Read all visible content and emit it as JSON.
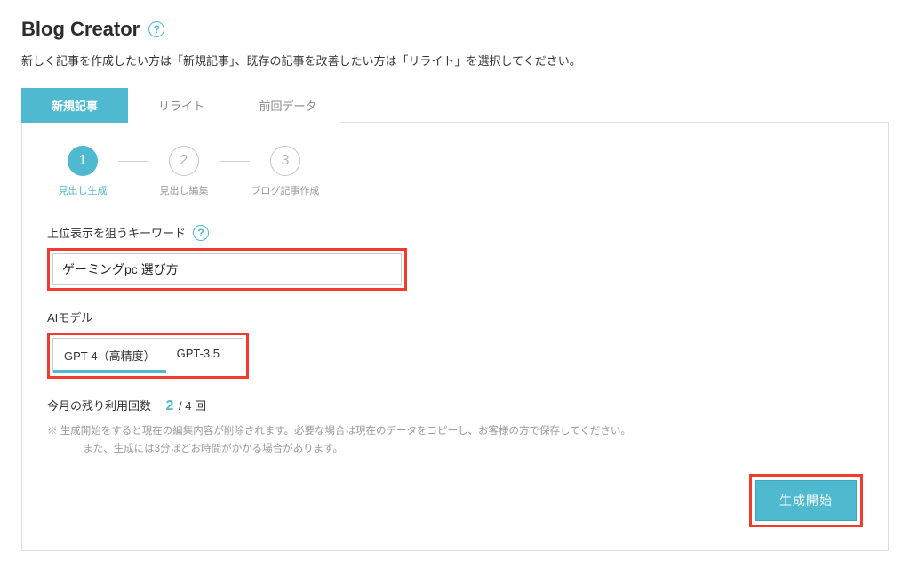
{
  "header": {
    "title": "Blog Creator",
    "subtitle": "新しく記事を作成したい方は「新規記事」、既存の記事を改善したい方は「リライト」を選択してください。"
  },
  "tabs": [
    {
      "label": "新規記事",
      "active": true
    },
    {
      "label": "リライト",
      "active": false
    },
    {
      "label": "前回データ",
      "active": false
    }
  ],
  "steps": [
    {
      "num": "1",
      "label": "見出し生成",
      "active": true
    },
    {
      "num": "2",
      "label": "見出し編集",
      "active": false
    },
    {
      "num": "3",
      "label": "ブログ記事作成",
      "active": false
    }
  ],
  "keyword": {
    "label": "上位表示を狙うキーワード",
    "value": "ゲーミングpc 選び方"
  },
  "model": {
    "label": "AIモデル",
    "options": [
      {
        "label": "GPT-4（高精度）",
        "selected": true
      },
      {
        "label": "GPT-3.5",
        "selected": false
      }
    ]
  },
  "usage": {
    "label": "今月の残り利用回数",
    "current": "2",
    "sep": " / ",
    "total": "4 回"
  },
  "notes": {
    "line1": "※ 生成開始をすると現在の編集内容が削除されます。必要な場合は現在のデータをコピーし、お客様の方で保存してください。",
    "line2": "また、生成には3分ほどお時間がかかる場合があります。"
  },
  "actions": {
    "generate": "生成開始"
  },
  "icons": {
    "help": "?"
  }
}
